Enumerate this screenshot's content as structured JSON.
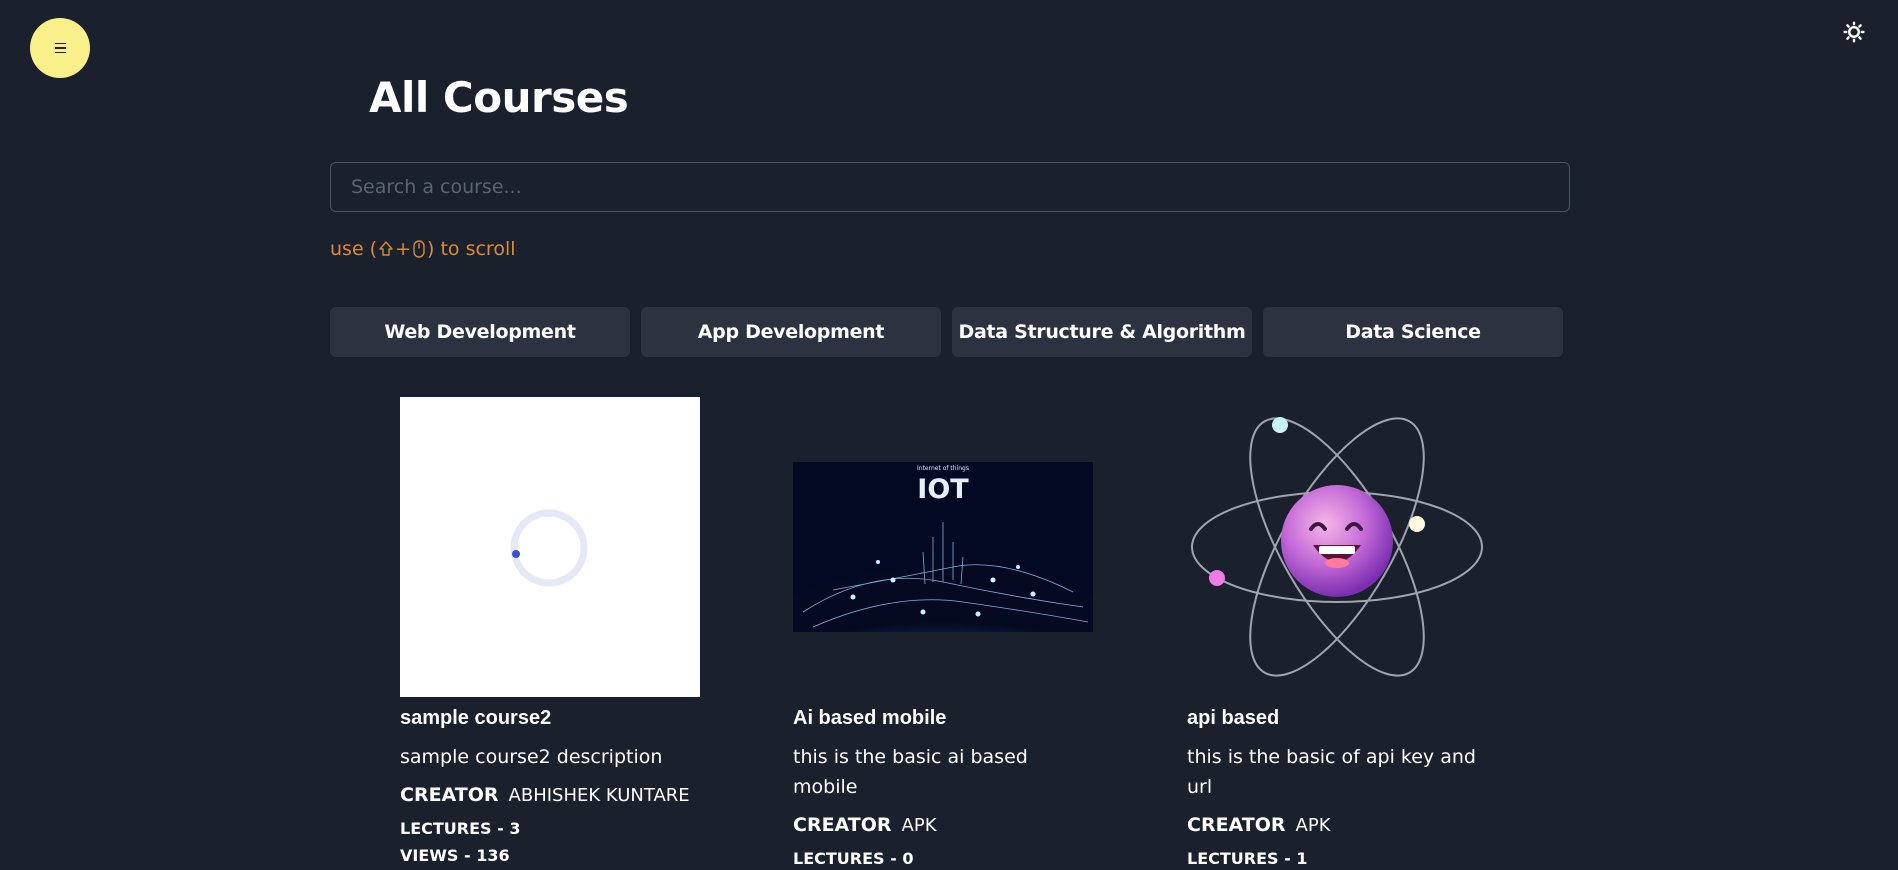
{
  "nav": {
    "menu_icon": "menu-icon",
    "theme_icon": "sun-icon"
  },
  "page": {
    "title": "All Courses"
  },
  "search": {
    "placeholder": "Search a course...",
    "value": ""
  },
  "scroll_hint": {
    "prefix": "use (",
    "plus": "+",
    "suffix": ") to scroll",
    "icons": [
      "shift-key-icon",
      "mouse-icon"
    ]
  },
  "categories": [
    {
      "label": "Web Development"
    },
    {
      "label": "App Development"
    },
    {
      "label": "Data Structure & Algorithm"
    },
    {
      "label": "Data Science"
    }
  ],
  "courses": [
    {
      "title": "sample course2",
      "description": "sample course2 description",
      "creator_label": "CREATOR",
      "creator": "ABHISHEK KUNTARE",
      "lectures": "LECTURES - 3",
      "views": "VIEWS - 136",
      "thumbnail": "loading-spinner"
    },
    {
      "title": "Ai based mobile",
      "description": "this is the basic ai based mobile",
      "creator_label": "CREATOR",
      "creator": "APK",
      "lectures": "LECTURES - 0",
      "thumbnail": "iot-network-globe",
      "thumbnail_caption": "Internet of things",
      "thumbnail_title": "IOT"
    },
    {
      "title": "api based",
      "description": "this is the basic of api key and url",
      "creator_label": "CREATOR",
      "creator": "APK",
      "lectures": "LECTURES - 1",
      "thumbnail": "atom-emoji"
    }
  ],
  "colors": {
    "background": "#1a202c",
    "menu_button": "#faf089",
    "category_button": "#2d3240",
    "hint": "#dd8a3a",
    "spinner": "#3b4fd8"
  }
}
